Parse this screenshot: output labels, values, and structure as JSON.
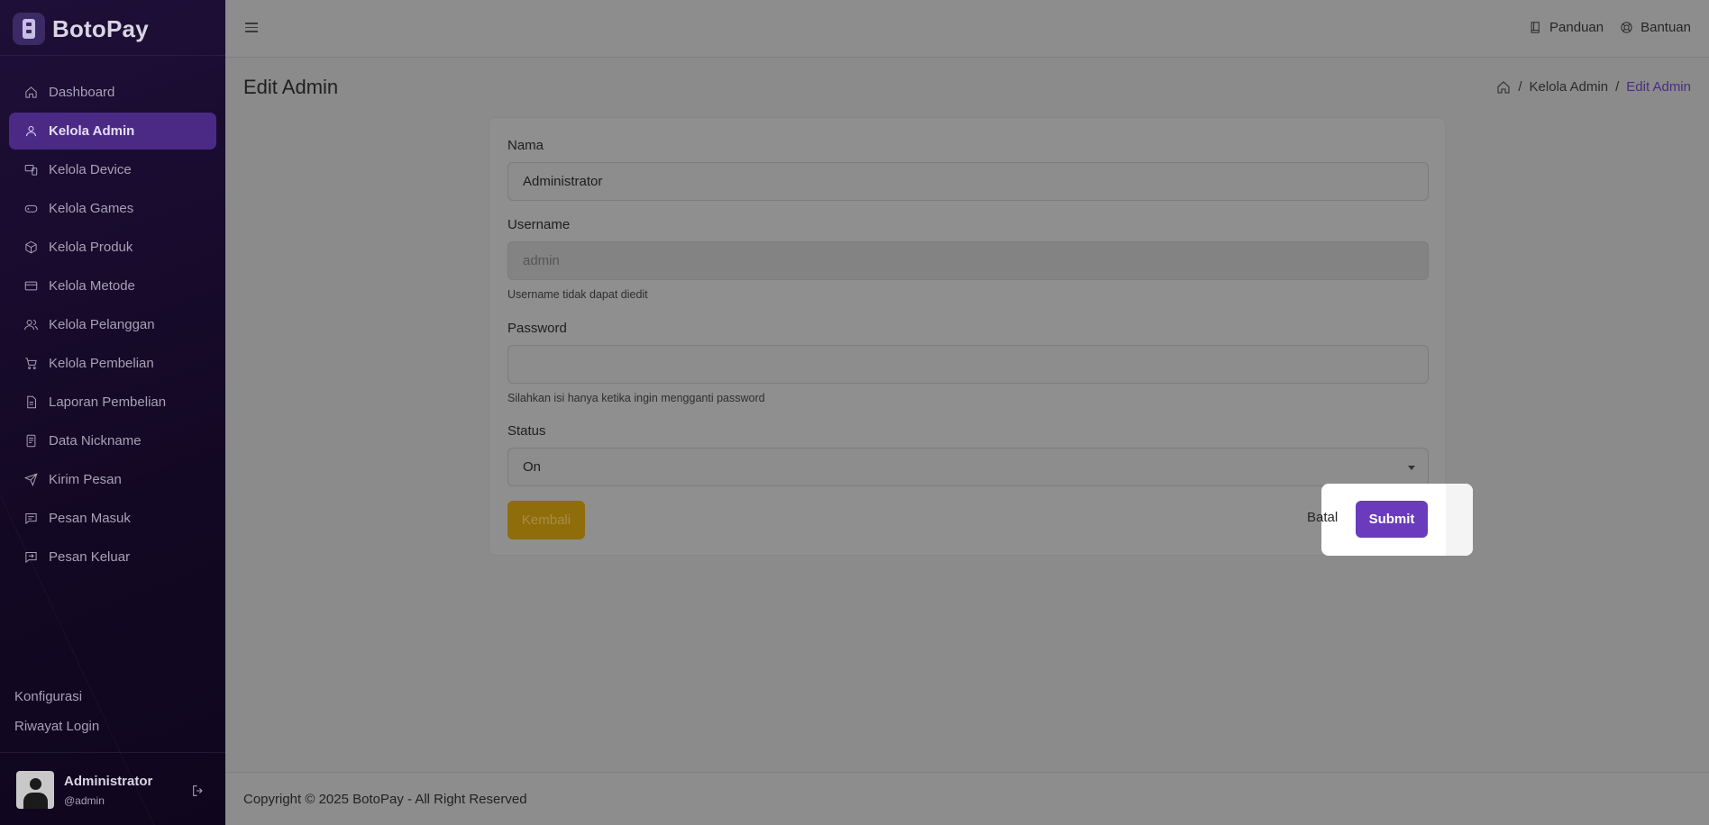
{
  "brand": {
    "name": "BotoPay"
  },
  "sidebar": {
    "items": [
      {
        "label": "Dashboard",
        "icon": "home-icon"
      },
      {
        "label": "Kelola Admin",
        "icon": "user-icon",
        "active": true
      },
      {
        "label": "Kelola Device",
        "icon": "device-icon"
      },
      {
        "label": "Kelola Games",
        "icon": "gamepad-icon"
      },
      {
        "label": "Kelola Produk",
        "icon": "box-icon"
      },
      {
        "label": "Kelola Metode",
        "icon": "card-icon"
      },
      {
        "label": "Kelola Pelanggan",
        "icon": "users-icon"
      },
      {
        "label": "Kelola Pembelian",
        "icon": "cart-icon"
      },
      {
        "label": "Laporan Pembelian",
        "icon": "file-icon"
      },
      {
        "label": "Data Nickname",
        "icon": "document-icon"
      },
      {
        "label": "Kirim Pesan",
        "icon": "send-icon"
      },
      {
        "label": "Pesan Masuk",
        "icon": "message-icon"
      },
      {
        "label": "Pesan Keluar",
        "icon": "message-out-icon"
      }
    ],
    "bottom": [
      "Konfigurasi",
      "Riwayat Login"
    ],
    "user": {
      "name": "Administrator",
      "handle": "@admin"
    }
  },
  "header": {
    "links": [
      "Panduan",
      "Bantuan"
    ]
  },
  "page": {
    "title": "Edit Admin",
    "breadcrumb": [
      "Kelola Admin",
      "Edit Admin"
    ]
  },
  "form": {
    "nama_label": "Nama",
    "nama_value": "Administrator",
    "username_label": "Username",
    "username_value": "admin",
    "username_help": "Username tidak dapat diedit",
    "password_label": "Password",
    "password_value": "",
    "password_help": "Silahkan isi hanya ketika ingin mengganti password",
    "status_label": "Status",
    "status_value": "On",
    "kembali_label": "Kembali",
    "batal_label": "Batal",
    "submit_label": "Submit"
  },
  "footer": {
    "text": "Copyright © 2025 BotoPay - All Right Reserved"
  }
}
